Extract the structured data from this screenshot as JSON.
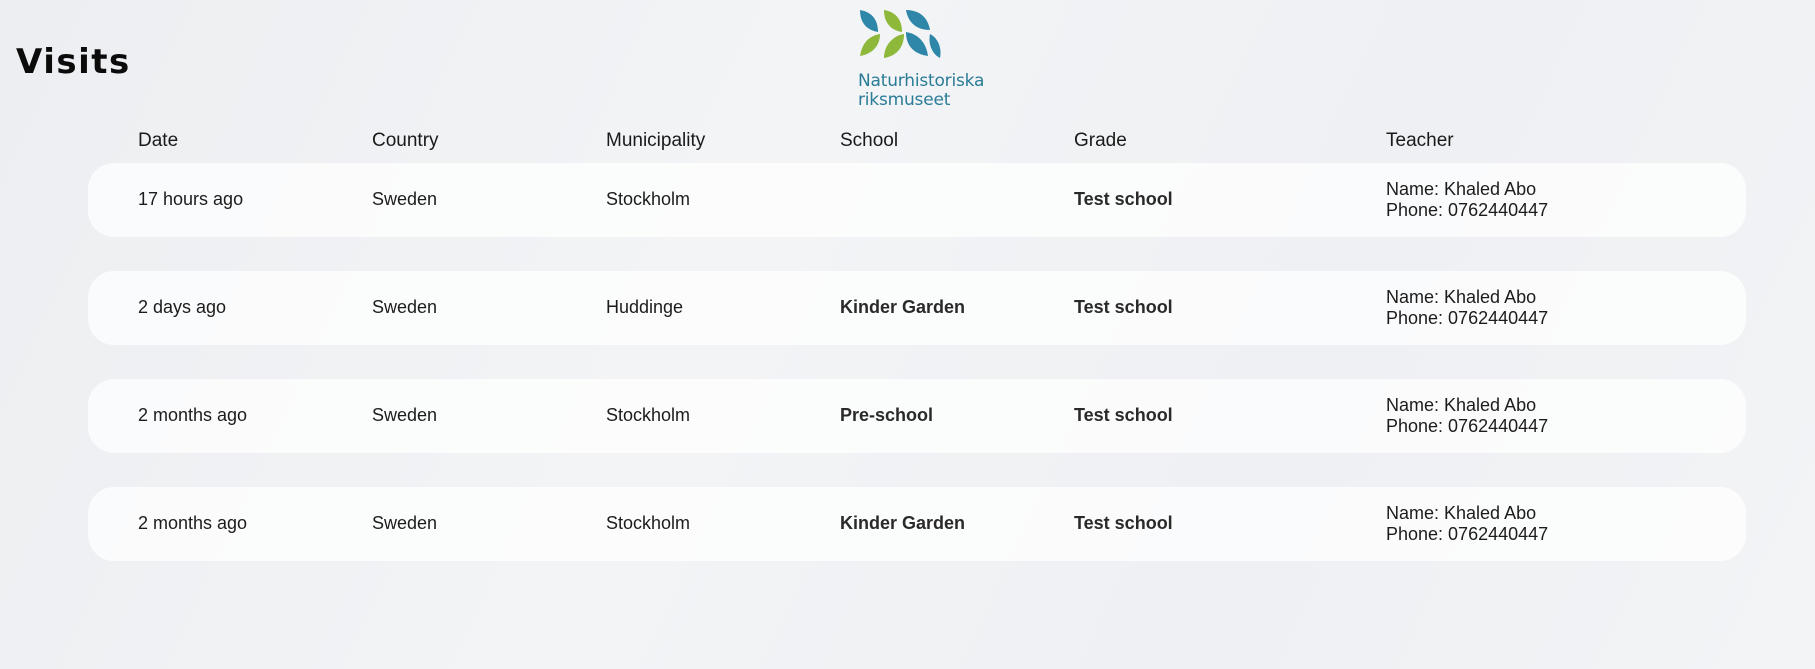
{
  "page": {
    "title": "Visits"
  },
  "logo": {
    "line1": "Naturhistoriska",
    "line2": "riksmuseet",
    "colors": {
      "blue": "#2e86a8",
      "green": "#8db83a"
    }
  },
  "table": {
    "headers": {
      "date": "Date",
      "country": "Country",
      "municipality": "Municipality",
      "school": "School",
      "grade": "Grade",
      "teacher": "Teacher"
    },
    "rows": [
      {
        "date": "17 hours ago",
        "country": "Sweden",
        "municipality": "Stockholm",
        "school": "",
        "grade": "Test school",
        "teacher_name": "Name: Khaled Abo",
        "teacher_phone": "Phone: 0762440447"
      },
      {
        "date": "2 days ago",
        "country": "Sweden",
        "municipality": "Huddinge",
        "school": "Kinder Garden",
        "grade": "Test school",
        "teacher_name": "Name: Khaled Abo",
        "teacher_phone": "Phone: 0762440447"
      },
      {
        "date": "2 months ago",
        "country": "Sweden",
        "municipality": "Stockholm",
        "school": "Pre-school",
        "grade": "Test school",
        "teacher_name": "Name: Khaled Abo",
        "teacher_phone": "Phone: 0762440447"
      },
      {
        "date": "2 months ago",
        "country": "Sweden",
        "municipality": "Stockholm",
        "school": "Kinder Garden",
        "grade": "Test school",
        "teacher_name": "Name: Khaled Abo",
        "teacher_phone": "Phone: 0762440447"
      }
    ]
  }
}
